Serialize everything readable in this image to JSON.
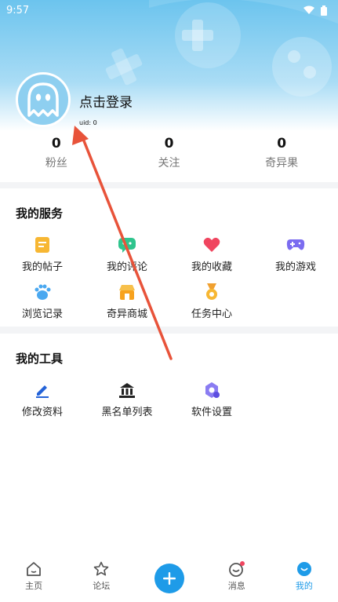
{
  "status_bar": {
    "time": "9:57"
  },
  "profile": {
    "login_text": "点击登录",
    "uid": "uid: 0"
  },
  "stats": [
    {
      "value": "0",
      "label": "粉丝"
    },
    {
      "value": "0",
      "label": "关注"
    },
    {
      "value": "0",
      "label": "奇异果"
    }
  ],
  "services": {
    "title": "我的服务",
    "items": [
      {
        "label": "我的帖子",
        "icon": "posts-icon"
      },
      {
        "label": "我的评论",
        "icon": "comments-icon"
      },
      {
        "label": "我的收藏",
        "icon": "heart-icon"
      },
      {
        "label": "我的游戏",
        "icon": "gamepad-icon"
      },
      {
        "label": "浏览记录",
        "icon": "paw-icon"
      },
      {
        "label": "奇异商城",
        "icon": "shop-icon"
      },
      {
        "label": "任务中心",
        "icon": "medal-icon"
      }
    ]
  },
  "tools": {
    "title": "我的工具",
    "items": [
      {
        "label": "修改资料",
        "icon": "pen-icon"
      },
      {
        "label": "黑名单列表",
        "icon": "blacklist-icon"
      },
      {
        "label": "软件设置",
        "icon": "settings-icon"
      }
    ]
  },
  "nav": [
    {
      "label": "主页",
      "icon": "home-icon"
    },
    {
      "label": "论坛",
      "icon": "star-icon"
    },
    {
      "label": "",
      "icon": "plus-icon"
    },
    {
      "label": "消息",
      "icon": "message-icon"
    },
    {
      "label": "我的",
      "icon": "me-icon"
    }
  ],
  "colors": {
    "accent": "#1e9be8",
    "arrow": "#e8533a"
  }
}
